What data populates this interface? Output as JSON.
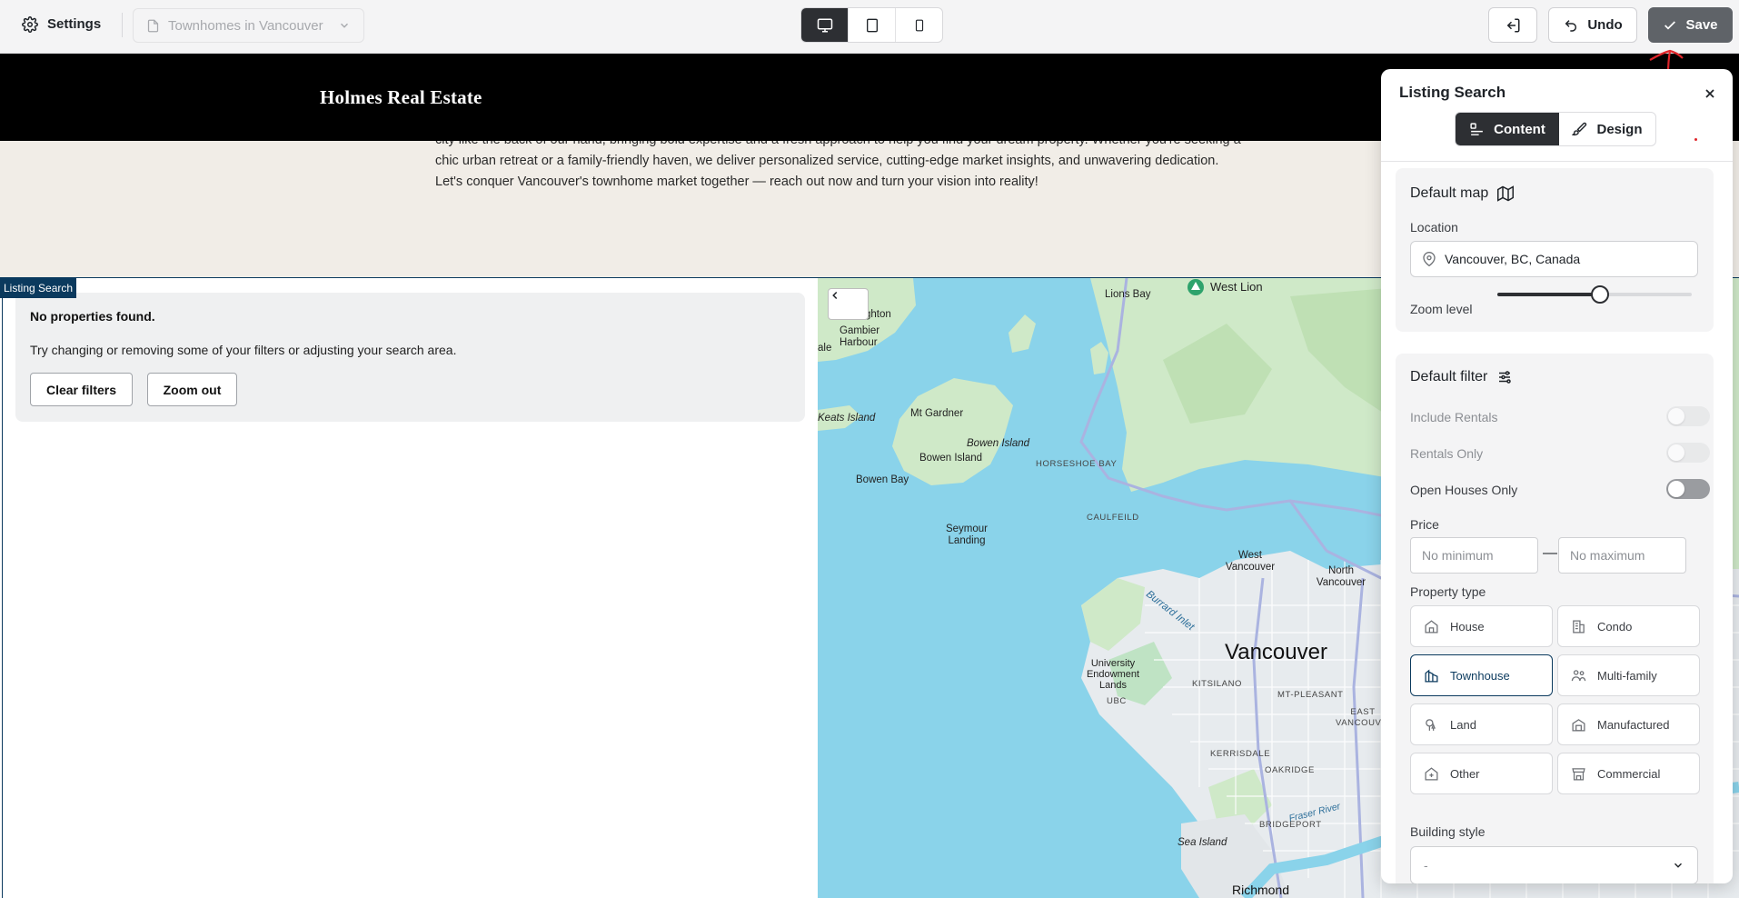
{
  "toolbar": {
    "settings_label": "Settings",
    "page_select_value": "Townhomes in Vancouver",
    "devices": [
      "desktop-icon",
      "tablet-icon",
      "mobile-icon"
    ],
    "undo_label": "Undo",
    "save_label": "Save"
  },
  "site": {
    "brand": "Holmes Real Estate",
    "about_lines": [
      "city like the back of our hand, bringing bold expertise and a fresh approach to help you find your dream property. Whether you're seeking a",
      "chic urban retreat or a family-friendly haven, we deliver personalized service, cutting-edge market insights, and unwavering dedication.",
      "Let's conquer Vancouver's townhome market together — reach out now and turn your vision into reality!"
    ]
  },
  "listing": {
    "section_tag": "Listing Search",
    "no_results_title": "No properties found.",
    "no_results_text": "Try changing or removing some of your filters or adjusting your search area.",
    "clear_filters_label": "Clear filters",
    "zoom_out_label": "Zoom out"
  },
  "map": {
    "labels": {
      "gibsons": "ghton",
      "gambier": "Gambier Harbour",
      "ale": "ale",
      "keats": "Keats Island",
      "mt_gardner": "Mt Gardner",
      "bowen_island_italic": "Bowen Island",
      "bowen_island": "Bowen Island",
      "bowen_bay": "Bowen Bay",
      "horseshoe_bay": "HORSESHOE BAY",
      "caulfeild": "CAULFEILD",
      "seymour_landing": "Seymour Landing",
      "lions_bay": "Lions Bay",
      "west_lion": "West Lion",
      "west_vancouver": "West Vancouver",
      "north_vancouver": "North Vancouver",
      "burrard_inlet": "Burrard Inlet",
      "vancouver": "Vancouver",
      "university_endowment": "University Endowment Lands",
      "ubc": "UBC",
      "kitsilano": "KITSILANO",
      "mt_pleasant": "MT-PLEASANT",
      "east_vancouver": "EAST VANCOUVER",
      "kerrisdale": "KERRISDALE",
      "oakridge": "OAKRIDGE",
      "fraser_river": "Fraser River",
      "bridgeport": "BRIDGEPORT",
      "sea_island": "Sea Island",
      "richmond": "Richmond"
    }
  },
  "panel": {
    "title": "Listing Search",
    "tabs": {
      "content": "Content",
      "design": "Design"
    },
    "default_map": {
      "title": "Default map",
      "location_label": "Location",
      "location_value": "Vancouver, BC, Canada",
      "zoom_label": "Zoom level",
      "zoom_fraction": 0.53
    },
    "default_filter": {
      "title": "Default filter",
      "include_rentals": "Include Rentals",
      "rentals_only": "Rentals Only",
      "open_houses_only": "Open Houses Only",
      "price_label": "Price",
      "price_min_placeholder": "No minimum",
      "price_max_placeholder": "No maximum",
      "price_dash": "—",
      "property_type_label": "Property type",
      "property_types": [
        "House",
        "Condo",
        "Townhouse",
        "Multi-family",
        "Land",
        "Manufactured",
        "Other",
        "Commercial"
      ],
      "selected_property_type": "Townhouse",
      "building_style_label": "Building style",
      "building_style_value": "-"
    }
  },
  "colors": {
    "accent": "#0b3a5e",
    "dark_button": "#2d2f33",
    "save_button": "#5f6368",
    "water": "#8ad3ea",
    "land": "#cfe9c8"
  }
}
